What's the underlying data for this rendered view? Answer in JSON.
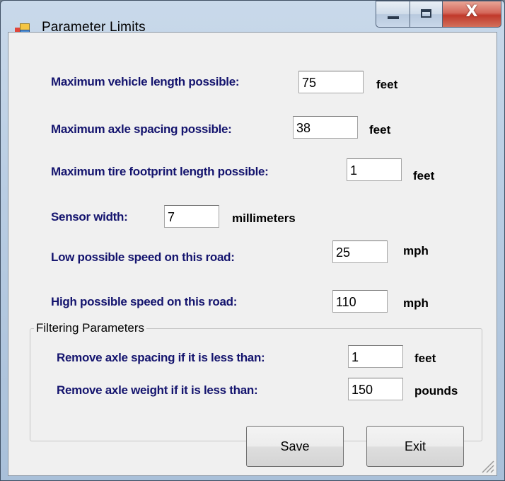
{
  "window": {
    "title": "Parameter Limits",
    "close_glyph": "X",
    "icons": [
      "app-icon",
      "minimize-icon",
      "maximize-icon",
      "close-icon",
      "size-grip-icon"
    ]
  },
  "fields": {
    "max_vehicle_length": {
      "label": "Maximum vehicle length possible:",
      "value": "75",
      "unit": "feet"
    },
    "max_axle_spacing": {
      "label": "Maximum axle spacing possible:",
      "value": "38",
      "unit": "feet"
    },
    "max_tire_footprint": {
      "label": "Maximum tire footprint length possible:",
      "value": "1",
      "unit": "feet"
    },
    "sensor_width": {
      "label": "Sensor width:",
      "value": "7",
      "unit": "millimeters"
    },
    "low_speed": {
      "label": "Low possible speed on this road:",
      "value": "25",
      "unit": "mph"
    },
    "high_speed": {
      "label": "High possible speed on this road:",
      "value": "110",
      "unit": "mph"
    }
  },
  "filtering": {
    "title": "Filtering Parameters",
    "remove_axle_spacing": {
      "label": "Remove axle spacing if it is less than:",
      "value": "1",
      "unit": "feet"
    },
    "remove_axle_weight": {
      "label": "Remove axle weight if it is less than:",
      "value": "150",
      "unit": "pounds"
    }
  },
  "buttons": {
    "save": "Save",
    "exit": "Exit"
  },
  "colors": {
    "label_text": "#14146e",
    "client_background": "#f0f0f0",
    "close_button": "#c0392b"
  }
}
